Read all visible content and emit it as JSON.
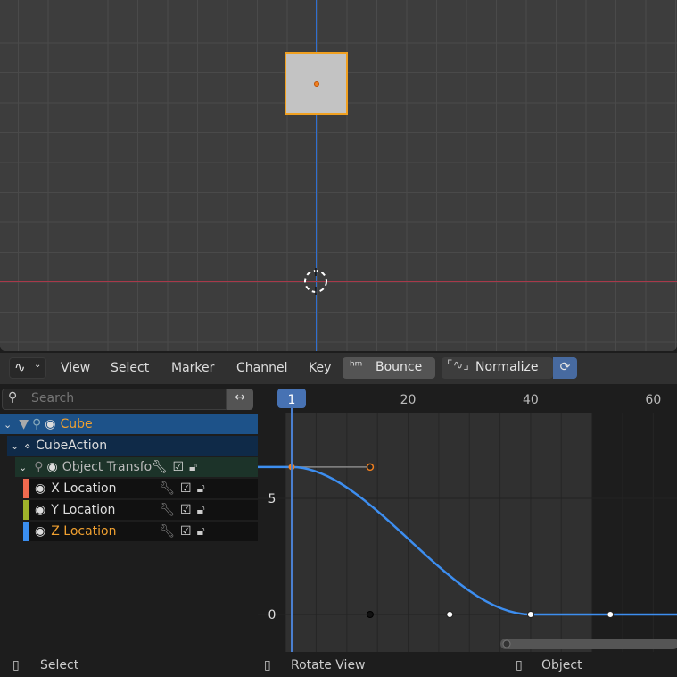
{
  "header": {
    "editor_icon": "graph-editor-icon",
    "menus": [
      "View",
      "Select",
      "Marker",
      "Channel",
      "Key"
    ],
    "interpolation_label": "Bounce",
    "normalize_label": "Normalize"
  },
  "channels": {
    "search_placeholder": "Search",
    "object": "Cube",
    "action": "CubeAction",
    "group": "Object Transfo",
    "curves": [
      {
        "label": "X Location",
        "color": "#f06a4f"
      },
      {
        "label": "Y Location",
        "color": "#9eb32a"
      },
      {
        "label": "Z Location",
        "color": "#3a8ef0"
      }
    ]
  },
  "graph": {
    "current_frame": "1",
    "frame_ticks": [
      "20",
      "40",
      "60"
    ],
    "value_ticks": [
      "5",
      "0"
    ],
    "curve_color": "#3d8ef0"
  },
  "chart_data": {
    "type": "line",
    "x_ticks": [
      20,
      40,
      60
    ],
    "y_ticks": [
      5,
      0
    ],
    "current_frame": 1,
    "scene_end_frame": 50,
    "keyframes": [
      {
        "frame": 1,
        "value": 6.35,
        "handle_right": [
          13.8,
          6.35
        ]
      },
      {
        "frame": 40,
        "value": 0,
        "handle_left": [
          26.8,
          0
        ],
        "handle_right": [
          53,
          0
        ]
      }
    ],
    "extra_points": [
      [
        13.8,
        0
      ]
    ]
  },
  "status": {
    "items": [
      "Select",
      "Rotate View",
      "Object"
    ]
  }
}
